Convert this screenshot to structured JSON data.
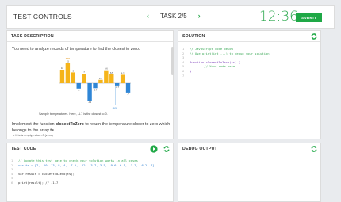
{
  "header": {
    "title": "TEST CONTROLS I",
    "task_label": "TASK 2/5",
    "prev_icon": "chevron-left-icon",
    "next_icon": "chevron-right-icon",
    "timer": "12:36",
    "submit_label": "SUBMIT",
    "accent": "#1fa846"
  },
  "description": {
    "title": "TASK DESCRIPTION",
    "intro": "You need to analyze records of temperature to find the closest to zero.",
    "caption": "Sample temperatures. Here, -1.7 is the closest to 0.",
    "impl_prefix": "Implement the function ",
    "func": "closestToZero",
    "impl_suffix": " to return the temperature closer to zero which belongs to the array ",
    "arr": "ts",
    "bullet": "If ts is empty, return 0 (zero)"
  },
  "chart_data": {
    "type": "bar",
    "values": [
      10,
      15,
      8,
      -4,
      7,
      -13,
      -3.7,
      2.5,
      9.6,
      6.5,
      -1.7,
      6.2,
      -7
    ],
    "data_labels": [
      "10",
      "15",
      "8",
      "-4",
      "7",
      "-13",
      "-3.7",
      "2.5",
      "9.6",
      "6.5",
      "-1.7",
      "6.2",
      "-7"
    ],
    "highlight_index": 10,
    "xlabel": "",
    "ylabel": "",
    "point_labels": {
      "max": "Max",
      "zero": "Zero"
    },
    "colors": {
      "positive": "#f5b41a",
      "negative": "#2f86d6",
      "highlight": "#5a5a5a"
    }
  },
  "solution": {
    "title": "SOLUTION",
    "lines": [
      {
        "n": "1",
        "cls": "c-com",
        "text": "// JavaScript code below"
      },
      {
        "n": "2",
        "cls": "c-com",
        "text": "// Use print(int ...) to debug your solution."
      },
      {
        "n": "3",
        "cls": "c-txt",
        "text": ""
      },
      {
        "n": "4",
        "cls": "c-key",
        "text": "function closestToZero(ts) {"
      },
      {
        "n": "5",
        "cls": "c-com",
        "text": "        // Your code here"
      },
      {
        "n": "6",
        "cls": "c-key",
        "text": "}"
      },
      {
        "n": "7",
        "cls": "c-txt",
        "text": ""
      }
    ]
  },
  "test_code": {
    "title": "TEST CODE",
    "lines": [
      {
        "n": "1",
        "cls": "c-com",
        "text": "// Update this test case to check your solution works in all cases"
      },
      {
        "n": "2",
        "cls": "c-str",
        "text": "var ts = [7, -10, 13, 8, 4, -7.2, -12, -3.7, 3.5, -9.6, 6.5, -1.7, -6.2, 7];"
      },
      {
        "n": "3",
        "cls": "c-txt",
        "text": ""
      },
      {
        "n": "4",
        "cls": "c-txt",
        "text": "var result = closestToZero(ts);"
      },
      {
        "n": "5",
        "cls": "c-txt",
        "text": ""
      },
      {
        "n": "6",
        "cls": "c-txt",
        "text": "print(result); // -1.7"
      }
    ]
  },
  "debug": {
    "title": "DEBUG OUTPUT"
  },
  "icons": {
    "refresh": "refresh-icon",
    "play": "play-icon"
  }
}
